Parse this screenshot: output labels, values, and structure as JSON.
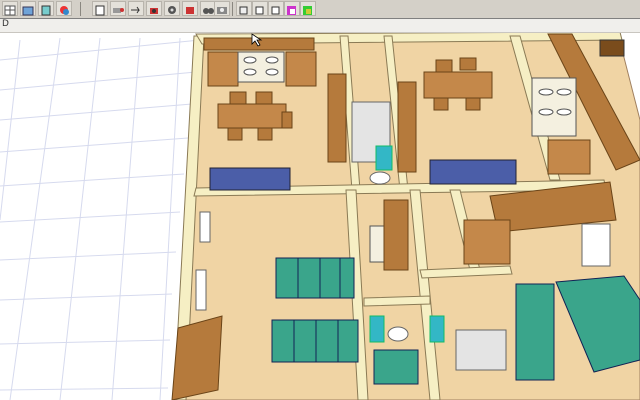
{
  "status_strip": {
    "label": "D"
  },
  "toolbar": {
    "buttons": [
      "grid-tool",
      "open-tool",
      "save-tool",
      "color-tool",
      "page-tool",
      "properties-tool",
      "move-tool",
      "camera-tool",
      "settings-tool",
      "render-tool",
      "walk-tool",
      "snapshot-tool",
      "view-top-tool",
      "view-front-tool",
      "view-side-tool",
      "view-perspective-tool",
      "view-color-tool"
    ]
  },
  "colors": {
    "toolbar": "#d4d0c8",
    "wall": "#f6efc4",
    "floor": "#f2d6a4",
    "wood": "#b57a3c",
    "wood_dark": "#7a4c1c",
    "sofa": "#3aa58b",
    "bed": "#3aa58b",
    "couch_blue": "#4b5ea8",
    "grid": "#d8dcf0"
  }
}
